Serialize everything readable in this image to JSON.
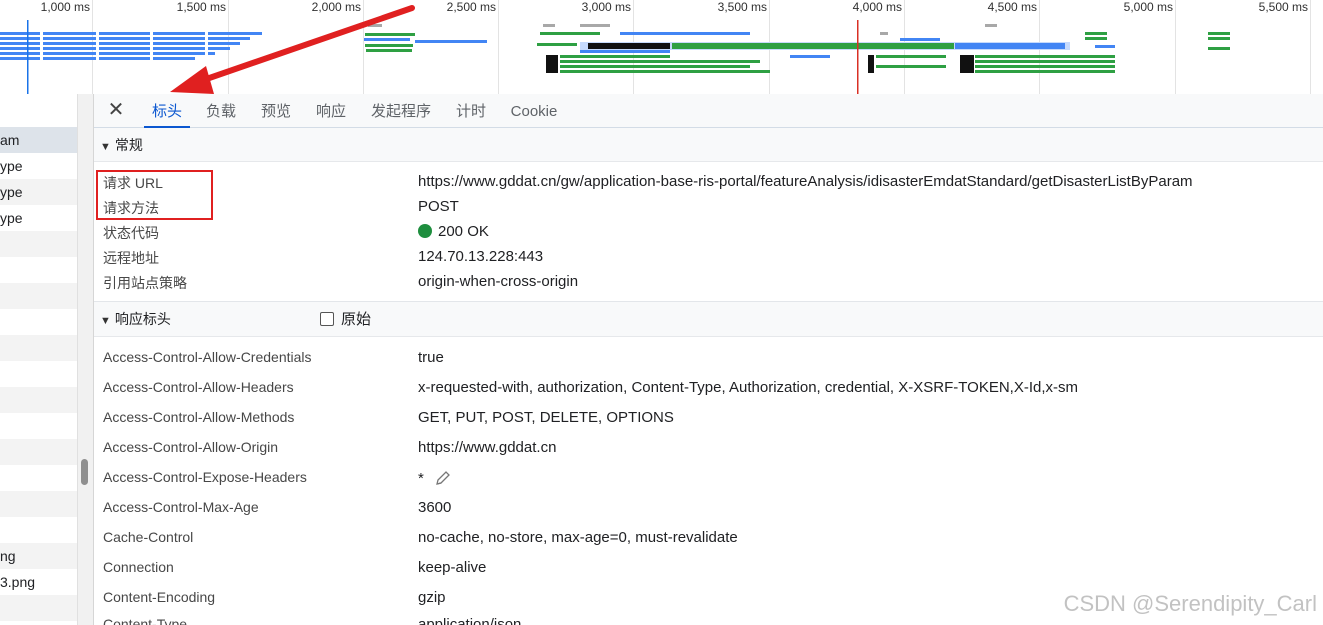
{
  "timeline": {
    "ticks": [
      {
        "label": "1,000 ms"
      },
      {
        "label": "1,500 ms"
      },
      {
        "label": "2,000 ms"
      },
      {
        "label": "2,500 ms"
      },
      {
        "label": "3,000 ms"
      },
      {
        "label": "3,500 ms"
      },
      {
        "label": "4,000 ms"
      },
      {
        "label": "4,500 ms"
      },
      {
        "label": "5,000 ms"
      },
      {
        "label": "5,500 ms"
      }
    ],
    "colors": {
      "waiting": "#2ea043",
      "download": "#4285f4",
      "queue": "#a8a8a8",
      "dom_marker": "#1a73e8",
      "load_marker": "#d93025"
    }
  },
  "request_list": {
    "rows": [
      "am",
      "ype",
      "ype",
      "ype",
      "",
      "",
      "",
      "",
      "",
      "",
      "",
      "",
      "",
      "",
      "",
      "",
      "ng",
      "3.png",
      "",
      ""
    ]
  },
  "details": {
    "close_icon": "close-icon",
    "tabs": [
      {
        "label": "标头",
        "active": true
      },
      {
        "label": "负载",
        "active": false
      },
      {
        "label": "预览",
        "active": false
      },
      {
        "label": "响应",
        "active": false
      },
      {
        "label": "发起程序",
        "active": false
      },
      {
        "label": "计时",
        "active": false
      },
      {
        "label": "Cookie",
        "active": false
      }
    ],
    "general": {
      "title": "常规",
      "rows": [
        {
          "key": "请求 URL",
          "value": "https://www.gddat.cn/gw/application-base-ris-portal/featureAnalysis/idisasterEmdatStandard/getDisasterListByParam"
        },
        {
          "key": "请求方法",
          "value": "POST"
        },
        {
          "key": "状态代码",
          "value": "200 OK",
          "status_color": "#1e8e3e"
        },
        {
          "key": "远程地址",
          "value": "124.70.13.228:443"
        },
        {
          "key": "引用站点策略",
          "value": "origin-when-cross-origin"
        }
      ]
    },
    "response_headers": {
      "title": "响应标头",
      "raw_label": "原始",
      "raw_checked": false,
      "rows": [
        {
          "key": "Access-Control-Allow-Credentials",
          "value": "true"
        },
        {
          "key": "Access-Control-Allow-Headers",
          "value": "x-requested-with, authorization, Content-Type, Authorization, credential, X-XSRF-TOKEN,X-Id,x-sm"
        },
        {
          "key": "Access-Control-Allow-Methods",
          "value": "GET, PUT, POST, DELETE, OPTIONS"
        },
        {
          "key": "Access-Control-Allow-Origin",
          "value": "https://www.gddat.cn"
        },
        {
          "key": "Access-Control-Expose-Headers",
          "value": "*"
        },
        {
          "key": "Access-Control-Max-Age",
          "value": "3600"
        },
        {
          "key": "Cache-Control",
          "value": "no-cache, no-store, max-age=0, must-revalidate"
        },
        {
          "key": "Connection",
          "value": "keep-alive"
        },
        {
          "key": "Content-Encoding",
          "value": "gzip"
        },
        {
          "key": "Content-Type",
          "value": "application/json"
        }
      ]
    }
  },
  "annotation": {
    "box_color": "#e02020",
    "arrow_color": "#e02020"
  },
  "watermark": "CSDN @Serendipity_Carl"
}
